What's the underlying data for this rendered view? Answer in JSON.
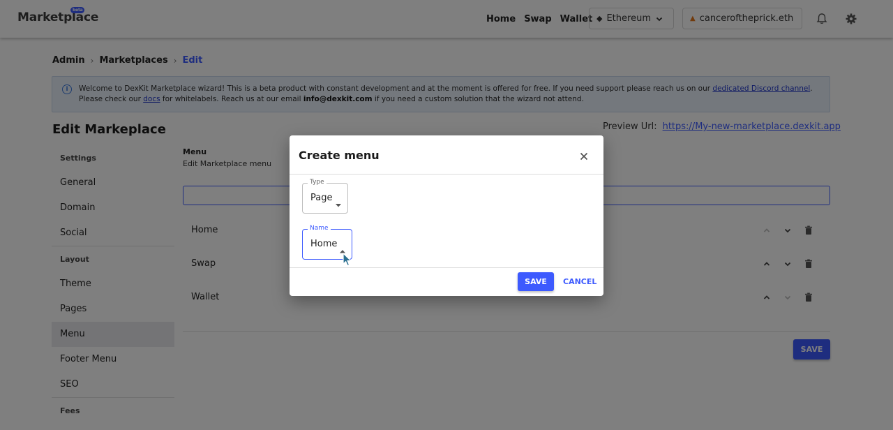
{
  "header": {
    "logo": "Marketplace",
    "logo_badge": "beta",
    "nav": [
      "Home",
      "Swap",
      "Wallet"
    ],
    "network": "Ethereum",
    "wallet": "canceroftheprick.eth"
  },
  "breadcrumb": {
    "items": [
      "Admin",
      "Marketplaces"
    ],
    "current": "Edit"
  },
  "alert": {
    "text_1": "Welcome to DexKit Marketplace wizard! This is a beta product with constant development and at the moment is offered for free. If you need support please reach us on our ",
    "discord_link": "dedicated Discord channel",
    "text_2": ". Please check our ",
    "docs_link": "docs",
    "text_3": " for whitelabels. Reach us at our email ",
    "email": "info@dexkit.com",
    "text_4": " if you need a custom solution that the wizard not attend."
  },
  "page": {
    "title": "Edit Markeplace",
    "preview_label": "Preview Url:",
    "preview_url": "https://My-new-marketplace.dexkit.app"
  },
  "sidebar": {
    "groups": [
      {
        "label": "Settings",
        "items": [
          "General",
          "Domain",
          "Social"
        ]
      },
      {
        "label": "Layout",
        "items": [
          "Theme",
          "Pages",
          "Menu",
          "Footer Menu",
          "SEO"
        ]
      },
      {
        "label": "Fees",
        "items": []
      }
    ],
    "active": "Menu"
  },
  "main": {
    "heading": "Menu",
    "subheading": "Edit Marketplace menu",
    "rows": [
      "Home",
      "Swap",
      "Wallet"
    ],
    "save_label": "SAVE"
  },
  "dialog": {
    "title": "Create menu",
    "type_legend": "Type",
    "type_value": "Page",
    "name_legend": "Name",
    "name_value": "Home",
    "save_label": "SAVE",
    "cancel_label": "CANCEL"
  },
  "colors": {
    "accent": "#3d5afe",
    "overlay": "rgba(0,0,0,0.5)"
  }
}
